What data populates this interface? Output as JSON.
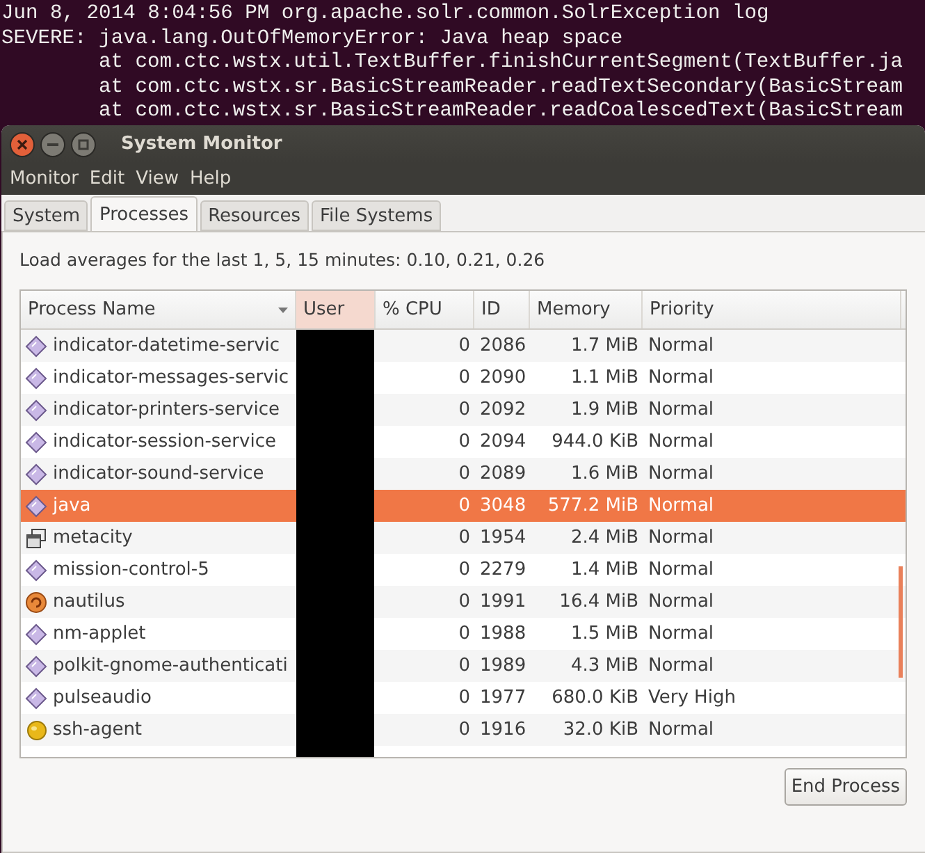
{
  "terminal": {
    "lines": [
      {
        "kind": "message",
        "text": "Jun 8, 2014 8:04:56 PM org.apache.solr.common.SolrException log"
      },
      {
        "kind": "message",
        "text": "SEVERE: java.lang.OutOfMemoryError: Java heap space"
      },
      {
        "kind": "frame",
        "text": "at com.ctc.wstx.util.TextBuffer.finishCurrentSegment(TextBuffer.ja"
      },
      {
        "kind": "frame",
        "text": "at com.ctc.wstx.sr.BasicStreamReader.readTextSecondary(BasicStream"
      },
      {
        "kind": "frame",
        "text": "at com.ctc.wstx.sr.BasicStreamReader.readCoalescedText(BasicStream"
      }
    ]
  },
  "window": {
    "title": "System Monitor"
  },
  "menu": [
    "Monitor",
    "Edit",
    "View",
    "Help"
  ],
  "tabs": [
    {
      "label": "System",
      "selected": false
    },
    {
      "label": "Processes",
      "selected": true
    },
    {
      "label": "Resources",
      "selected": false
    },
    {
      "label": "File Systems",
      "selected": false
    }
  ],
  "load_averages": "Load averages for the last 1, 5, 15 minutes: 0.10, 0.21, 0.26",
  "table": {
    "columns": [
      {
        "label": "Process Name",
        "selected": false
      },
      {
        "label": "User",
        "selected": true
      },
      {
        "label": "% CPU",
        "selected": false
      },
      {
        "label": "ID",
        "selected": false
      },
      {
        "label": "Memory",
        "selected": false
      },
      {
        "label": "Priority",
        "selected": false
      }
    ],
    "rows": [
      {
        "kind": "diamond",
        "name": "indicator-datetime-servic",
        "cpu": "0",
        "id": "2086",
        "memory": "1.7 MiB",
        "priority": "Normal",
        "selected": false
      },
      {
        "kind": "diamond",
        "name": "indicator-messages-servic",
        "cpu": "0",
        "id": "2090",
        "memory": "1.1 MiB",
        "priority": "Normal",
        "selected": false
      },
      {
        "kind": "diamond",
        "name": "indicator-printers-service",
        "cpu": "0",
        "id": "2092",
        "memory": "1.9 MiB",
        "priority": "Normal",
        "selected": false
      },
      {
        "kind": "diamond",
        "name": "indicator-session-service",
        "cpu": "0",
        "id": "2094",
        "memory": "944.0 KiB",
        "priority": "Normal",
        "selected": false
      },
      {
        "kind": "diamond",
        "name": "indicator-sound-service",
        "cpu": "0",
        "id": "2089",
        "memory": "1.6 MiB",
        "priority": "Normal",
        "selected": false
      },
      {
        "kind": "diamond",
        "name": "java",
        "cpu": "0",
        "id": "3048",
        "memory": "577.2 MiB",
        "priority": "Normal",
        "selected": true
      },
      {
        "kind": "window",
        "name": "metacity",
        "cpu": "0",
        "id": "1954",
        "memory": "2.4 MiB",
        "priority": "Normal",
        "selected": false
      },
      {
        "kind": "diamond",
        "name": "mission-control-5",
        "cpu": "0",
        "id": "2279",
        "memory": "1.4 MiB",
        "priority": "Normal",
        "selected": false
      },
      {
        "kind": "shell",
        "name": "nautilus",
        "cpu": "0",
        "id": "1991",
        "memory": "16.4 MiB",
        "priority": "Normal",
        "selected": false
      },
      {
        "kind": "diamond",
        "name": "nm-applet",
        "cpu": "0",
        "id": "1988",
        "memory": "1.5 MiB",
        "priority": "Normal",
        "selected": false
      },
      {
        "kind": "diamond",
        "name": "polkit-gnome-authenticati",
        "cpu": "0",
        "id": "1989",
        "memory": "4.3 MiB",
        "priority": "Normal",
        "selected": false
      },
      {
        "kind": "diamond",
        "name": "pulseaudio",
        "cpu": "0",
        "id": "1977",
        "memory": "680.0 KiB",
        "priority": "Very High",
        "selected": false
      },
      {
        "kind": "agent",
        "name": "ssh-agent",
        "cpu": "0",
        "id": "1916",
        "memory": "32.0 KiB",
        "priority": "Normal",
        "selected": false
      }
    ]
  },
  "end_button": "End Process"
}
